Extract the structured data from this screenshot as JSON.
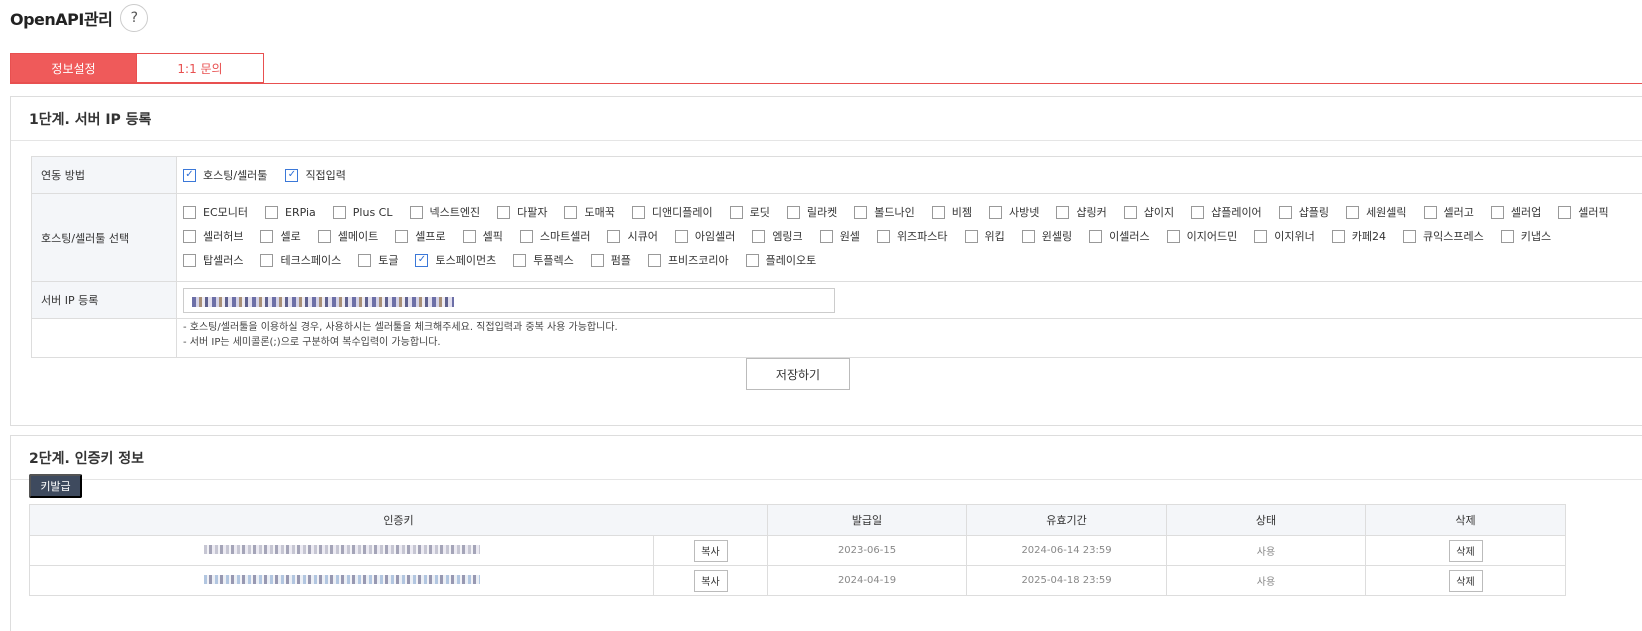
{
  "page": {
    "title": "OpenAPI관리",
    "help_label": "?"
  },
  "tabs": [
    {
      "label": "정보설정",
      "active": true
    },
    {
      "label": "1:1 문의",
      "active": false
    }
  ],
  "step1": {
    "title": "1단계. 서버 IP 등록",
    "method_label": "연동 방법",
    "methods": [
      {
        "label": "호스팅/셀러툴",
        "checked": true
      },
      {
        "label": "직접입력",
        "checked": true
      }
    ],
    "hosting_label": "호스팅/셀러툴 선택",
    "hosting_options": [
      {
        "label": "EC모니터",
        "checked": false
      },
      {
        "label": "ERPia",
        "checked": false
      },
      {
        "label": "Plus CL",
        "checked": false
      },
      {
        "label": "넥스트엔진",
        "checked": false
      },
      {
        "label": "다팔자",
        "checked": false
      },
      {
        "label": "도매꾹",
        "checked": false
      },
      {
        "label": "디앤디플레이",
        "checked": false
      },
      {
        "label": "로딧",
        "checked": false
      },
      {
        "label": "릴라켓",
        "checked": false
      },
      {
        "label": "볼드나인",
        "checked": false
      },
      {
        "label": "비젬",
        "checked": false
      },
      {
        "label": "사방넷",
        "checked": false
      },
      {
        "label": "샵링커",
        "checked": false
      },
      {
        "label": "샵이지",
        "checked": false
      },
      {
        "label": "샵플레이어",
        "checked": false
      },
      {
        "label": "샵플링",
        "checked": false
      },
      {
        "label": "세원셀릭",
        "checked": false
      },
      {
        "label": "셀러고",
        "checked": false
      },
      {
        "label": "셀러업",
        "checked": false
      },
      {
        "label": "셀러픽",
        "checked": false
      },
      {
        "label": "셀러허브",
        "checked": false
      },
      {
        "label": "셀로",
        "checked": false
      },
      {
        "label": "셀메이트",
        "checked": false
      },
      {
        "label": "셀프로",
        "checked": false
      },
      {
        "label": "셀픽",
        "checked": false
      },
      {
        "label": "스마트셀러",
        "checked": false
      },
      {
        "label": "시큐어",
        "checked": false
      },
      {
        "label": "아임셀러",
        "checked": false
      },
      {
        "label": "엠링크",
        "checked": false
      },
      {
        "label": "원셀",
        "checked": false
      },
      {
        "label": "위즈파스타",
        "checked": false
      },
      {
        "label": "위킵",
        "checked": false
      },
      {
        "label": "윈셀링",
        "checked": false
      },
      {
        "label": "이셀러스",
        "checked": false
      },
      {
        "label": "이지어드민",
        "checked": false
      },
      {
        "label": "이지위너",
        "checked": false
      },
      {
        "label": "카페24",
        "checked": false
      },
      {
        "label": "큐익스프레스",
        "checked": false
      },
      {
        "label": "키냅스",
        "checked": false
      },
      {
        "label": "탑셀러스",
        "checked": false
      },
      {
        "label": "테크스페이스",
        "checked": false
      },
      {
        "label": "토글",
        "checked": false
      },
      {
        "label": "토스페이먼츠",
        "checked": true
      },
      {
        "label": "투플렉스",
        "checked": false
      },
      {
        "label": "펌플",
        "checked": false
      },
      {
        "label": "프비즈코리아",
        "checked": false
      },
      {
        "label": "플레이오토",
        "checked": false
      }
    ],
    "ip_label": "서버 IP 등록",
    "notes": [
      "- 호스팅/셀러툴을 이용하실 경우, 사용하시는 셀러툴을 체크해주세요. 직접입력과 중복 사용 가능합니다.",
      "- 서버 IP는 세미콜론(;)으로 구분하여 복수입력이 가능합니다."
    ],
    "save_label": "저장하기"
  },
  "step2": {
    "title": "2단계. 인증키 정보",
    "issue_label": "키발급",
    "columns": [
      "인증키",
      "발급일",
      "유효기간",
      "상태",
      "삭제"
    ],
    "rows": [
      {
        "copy": "복사",
        "issued": "2023-06-15",
        "expires": "2024-06-14 23:59",
        "status": "사용",
        "delete": "삭제"
      },
      {
        "copy": "복사",
        "issued": "2024-04-19",
        "expires": "2025-04-18 23:59",
        "status": "사용",
        "delete": "삭제"
      }
    ]
  },
  "colors": {
    "accent": "#ef5a5a",
    "check": "#3b78d8",
    "dark_button": "#3e4a5e"
  },
  "icons": {
    "checkbox_checked": "✓"
  }
}
